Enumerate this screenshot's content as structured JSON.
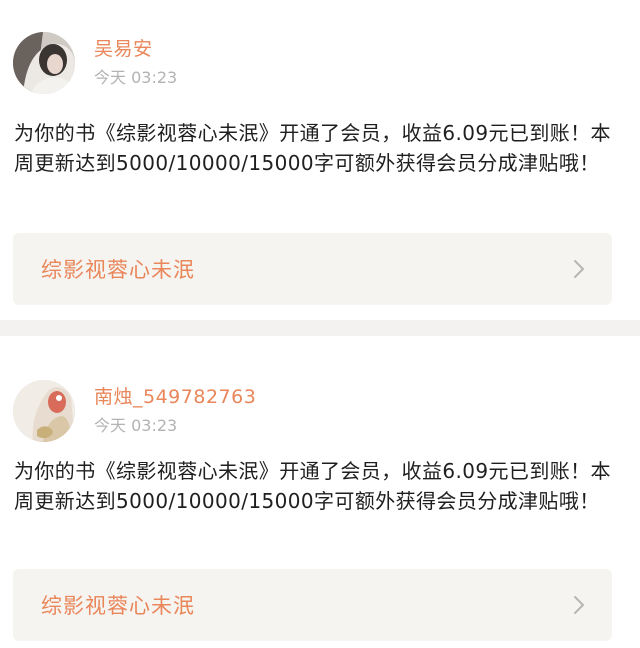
{
  "notifications": [
    {
      "username": "吴易安",
      "time": "今天 03:23",
      "message": "为你的书《综影视蓉心未泯》开通了会员，收益6.09元已到账！本周更新达到5000/10000/15000字可额外获得会员分成津贴哦！",
      "book_title": "综影视蓉心未泯",
      "avatar_icon": "user-avatar-photo",
      "chevron_icon": "chevron-right-icon"
    },
    {
      "username": "南烛_549782763",
      "time": "今天 03:23",
      "message": "为你的书《综影视蓉心未泯》开通了会员，收益6.09元已到账！本周更新达到5000/10000/15000字可额外获得会员分成津贴哦！",
      "book_title": "综影视蓉心未泯",
      "avatar_icon": "user-avatar-photo",
      "chevron_icon": "chevron-right-icon"
    }
  ],
  "colors": {
    "accent": "#e9865a",
    "time_gray": "#b3b3b3",
    "link_bg": "#f6f4f0",
    "divider": "#f3f2f0"
  }
}
